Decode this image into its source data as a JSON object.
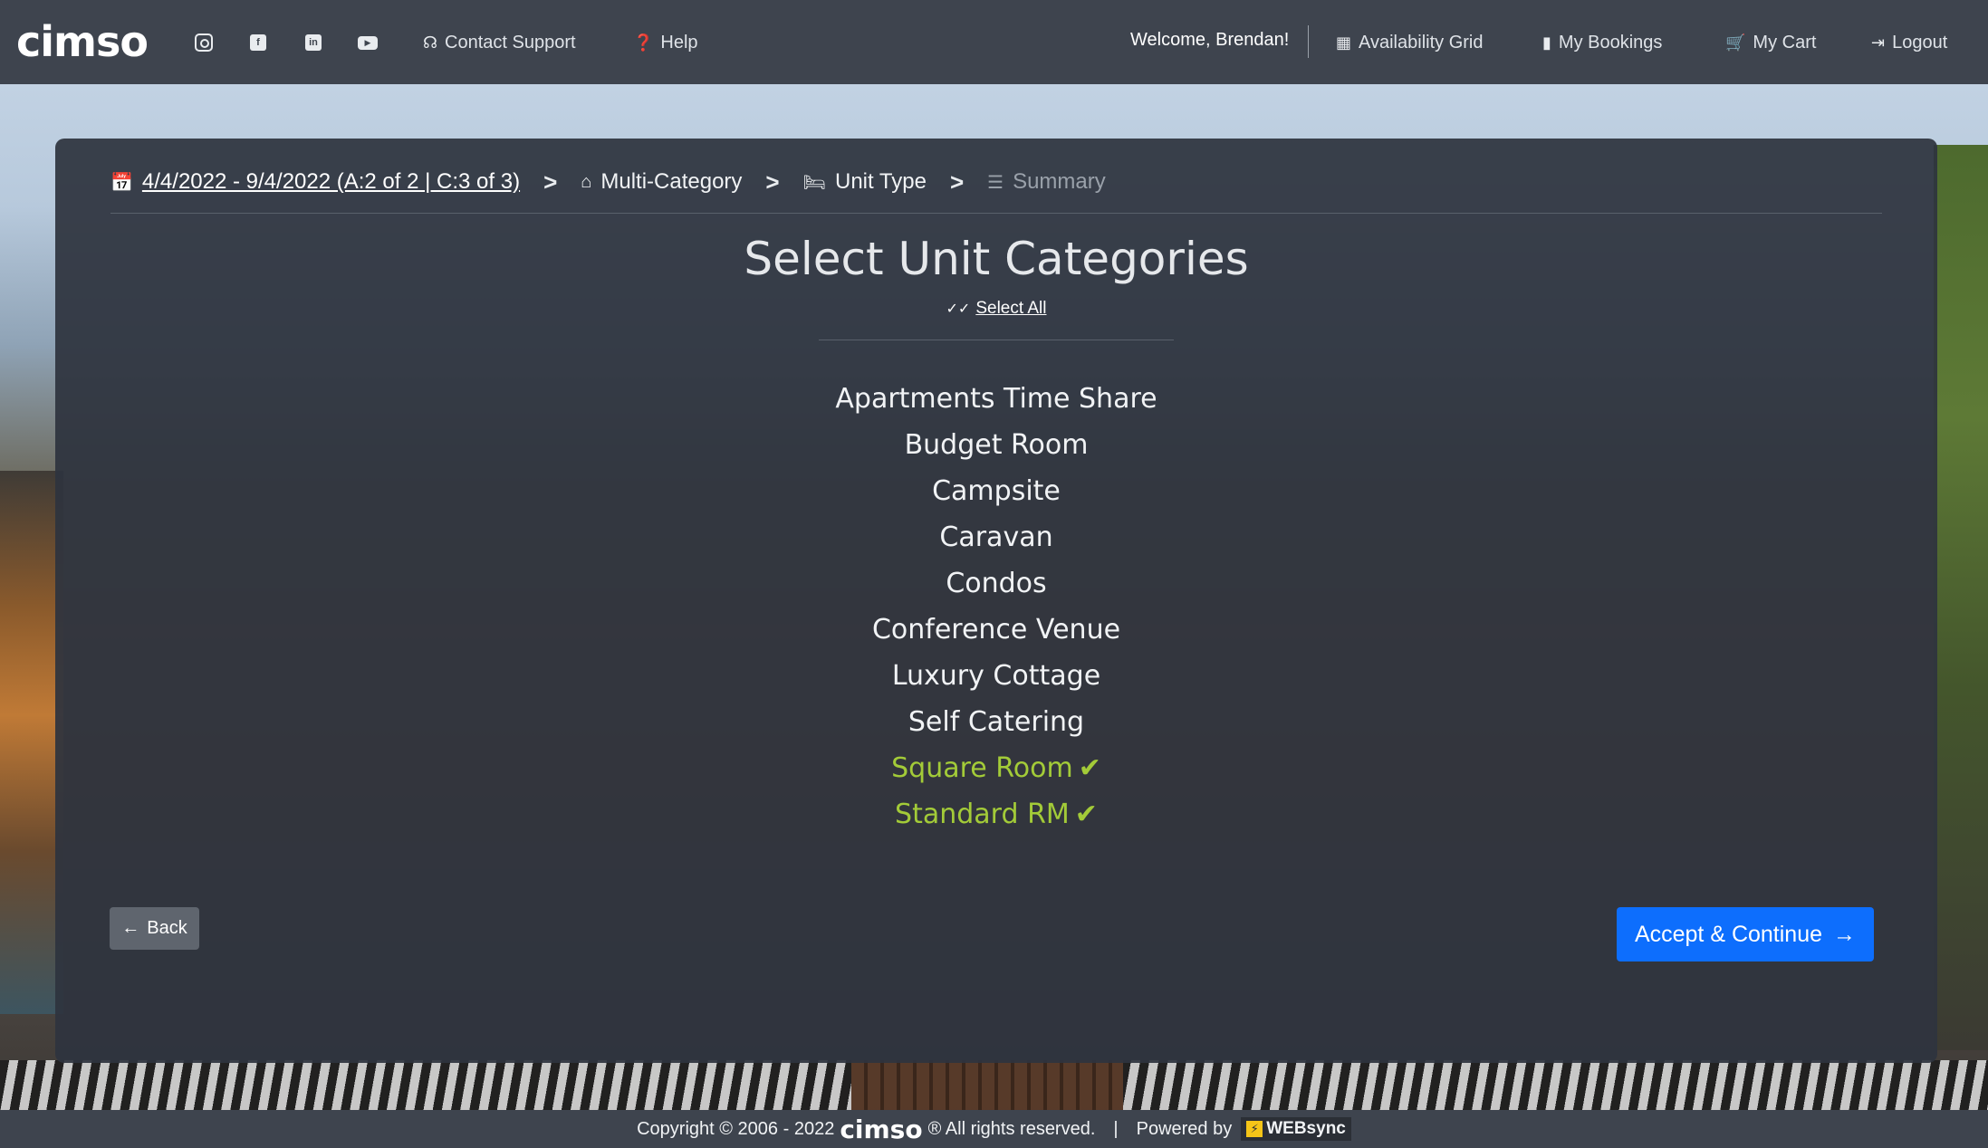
{
  "header": {
    "logo": "cimso",
    "social_icons": [
      "instagram-icon",
      "facebook-icon",
      "linkedin-icon",
      "youtube-icon"
    ],
    "contact_support": "Contact Support",
    "help": "Help",
    "welcome": "Welcome, Brendan!",
    "availability_grid": "Availability Grid",
    "my_bookings": "My Bookings",
    "my_cart": "My Cart",
    "logout": "Logout"
  },
  "breadcrumb": {
    "dates": "4/4/2022 - 9/4/2022 (A:2 of 2 | C:3 of 3)",
    "separator": ">",
    "multi_category": "Multi-Category",
    "unit_type": "Unit Type",
    "summary": "Summary"
  },
  "main": {
    "title": "Select Unit Categories",
    "select_all": "Select All",
    "categories": [
      {
        "label": "Apartments Time Share",
        "selected": false
      },
      {
        "label": "Budget Room",
        "selected": false
      },
      {
        "label": "Campsite",
        "selected": false
      },
      {
        "label": "Caravan",
        "selected": false
      },
      {
        "label": "Condos",
        "selected": false
      },
      {
        "label": "Conference Venue",
        "selected": false
      },
      {
        "label": "Luxury Cottage",
        "selected": false
      },
      {
        "label": "Self Catering",
        "selected": false
      },
      {
        "label": "Square Room",
        "selected": true
      },
      {
        "label": "Standard RM",
        "selected": true
      }
    ],
    "back": "Back",
    "accept": "Accept & Continue"
  },
  "footer": {
    "copyright": "Copyright © 2006 - 2022",
    "logo": "cimso",
    "rights": "® All rights reserved.",
    "separator": "|",
    "powered_by": "Powered by",
    "websync": "WEBsync"
  },
  "colors": {
    "topbar": "#3e444e",
    "card": "#2e343e",
    "accent_selected": "#a3cb38",
    "primary_button": "#0d6efd",
    "secondary_button": "#5f656e"
  }
}
